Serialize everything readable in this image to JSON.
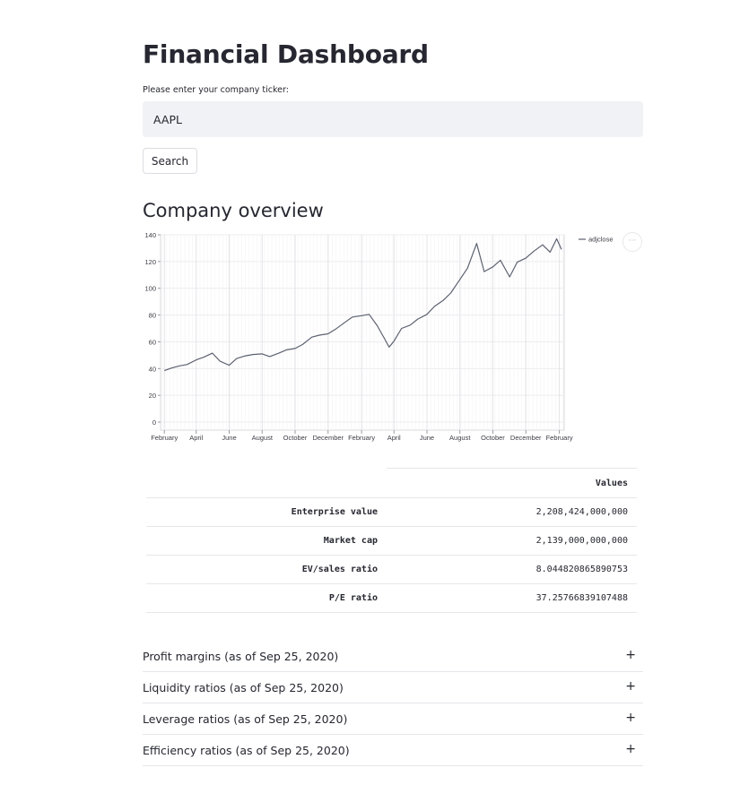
{
  "header": {
    "title": "Financial Dashboard",
    "ticker_label": "Please enter your company ticker:",
    "ticker_value": "AAPL",
    "search_label": "Search"
  },
  "overview": {
    "title": "Company overview",
    "more_label": "···"
  },
  "chart_data": {
    "type": "line",
    "series": [
      {
        "name": "adjclose",
        "color": "#5c6170",
        "points": [
          [
            "2019-02-01",
            38.5
          ],
          [
            "2019-02-15",
            40.5
          ],
          [
            "2019-03-01",
            42.0
          ],
          [
            "2019-03-15",
            43.0
          ],
          [
            "2019-04-01",
            46.5
          ],
          [
            "2019-04-15",
            48.5
          ],
          [
            "2019-05-01",
            51.5
          ],
          [
            "2019-05-15",
            45.5
          ],
          [
            "2019-06-01",
            42.5
          ],
          [
            "2019-06-15",
            47.5
          ],
          [
            "2019-07-01",
            49.5
          ],
          [
            "2019-07-15",
            50.5
          ],
          [
            "2019-08-01",
            51.0
          ],
          [
            "2019-08-15",
            49.0
          ],
          [
            "2019-09-01",
            51.5
          ],
          [
            "2019-09-15",
            54.0
          ],
          [
            "2019-10-01",
            55.0
          ],
          [
            "2019-10-15",
            58.0
          ],
          [
            "2019-11-01",
            63.5
          ],
          [
            "2019-11-15",
            65.0
          ],
          [
            "2019-12-01",
            66.0
          ],
          [
            "2019-12-15",
            69.5
          ],
          [
            "2020-01-01",
            74.5
          ],
          [
            "2020-01-15",
            78.5
          ],
          [
            "2020-02-01",
            79.5
          ],
          [
            "2020-02-15",
            80.5
          ],
          [
            "2020-03-01",
            72.0
          ],
          [
            "2020-03-15",
            62.0
          ],
          [
            "2020-03-23",
            56.0
          ],
          [
            "2020-04-01",
            60.5
          ],
          [
            "2020-04-15",
            70.0
          ],
          [
            "2020-05-01",
            72.5
          ],
          [
            "2020-05-15",
            77.0
          ],
          [
            "2020-06-01",
            80.5
          ],
          [
            "2020-06-15",
            86.5
          ],
          [
            "2020-07-01",
            91.0
          ],
          [
            "2020-07-15",
            96.5
          ],
          [
            "2020-07-31",
            106.0
          ],
          [
            "2020-08-15",
            115.0
          ],
          [
            "2020-09-01",
            133.5
          ],
          [
            "2020-09-15",
            112.5
          ],
          [
            "2020-10-01",
            116.0
          ],
          [
            "2020-10-15",
            121.0
          ],
          [
            "2020-11-01",
            108.5
          ],
          [
            "2020-11-15",
            119.5
          ],
          [
            "2020-12-01",
            122.5
          ],
          [
            "2020-12-15",
            127.5
          ],
          [
            "2021-01-01",
            132.5
          ],
          [
            "2021-01-15",
            127.0
          ],
          [
            "2021-01-27",
            137.0
          ],
          [
            "2021-02-05",
            129.0
          ]
        ]
      }
    ],
    "xlabel": "",
    "ylabel": "",
    "xlim": [
      "2019-01-25",
      "2021-02-10"
    ],
    "ylim": [
      -6,
      140
    ],
    "yticks": [
      0,
      20,
      40,
      60,
      80,
      100,
      120,
      140
    ],
    "xticks": [
      {
        "date": "2019-02-01",
        "label": "February"
      },
      {
        "date": "2019-04-01",
        "label": "April"
      },
      {
        "date": "2019-06-01",
        "label": "June"
      },
      {
        "date": "2019-08-01",
        "label": "August"
      },
      {
        "date": "2019-10-01",
        "label": "October"
      },
      {
        "date": "2019-12-01",
        "label": "December"
      },
      {
        "date": "2020-02-01",
        "label": "February"
      },
      {
        "date": "2020-04-01",
        "label": "April"
      },
      {
        "date": "2020-06-01",
        "label": "June"
      },
      {
        "date": "2020-08-01",
        "label": "August"
      },
      {
        "date": "2020-10-01",
        "label": "October"
      },
      {
        "date": "2020-12-01",
        "label": "December"
      },
      {
        "date": "2021-02-01",
        "label": "February"
      }
    ],
    "grid": true,
    "legend": "top-right"
  },
  "table": {
    "column_header": "Values",
    "rows": [
      {
        "label": "Enterprise value",
        "value": "2,208,424,000,000"
      },
      {
        "label": "Market cap",
        "value": "2,139,000,000,000"
      },
      {
        "label": "EV/sales ratio",
        "value": "8.044820865890753"
      },
      {
        "label": "P/E ratio",
        "value": "37.25766839107488"
      }
    ]
  },
  "expanders": [
    {
      "label": "Profit margins (as of Sep 25, 2020)",
      "icon": "+"
    },
    {
      "label": "Liquidity ratios (as of Sep 25, 2020)",
      "icon": "+"
    },
    {
      "label": "Leverage ratios (as of Sep 25, 2020)",
      "icon": "+"
    },
    {
      "label": "Efficiency ratios (as of Sep 25, 2020)",
      "icon": "+"
    }
  ]
}
